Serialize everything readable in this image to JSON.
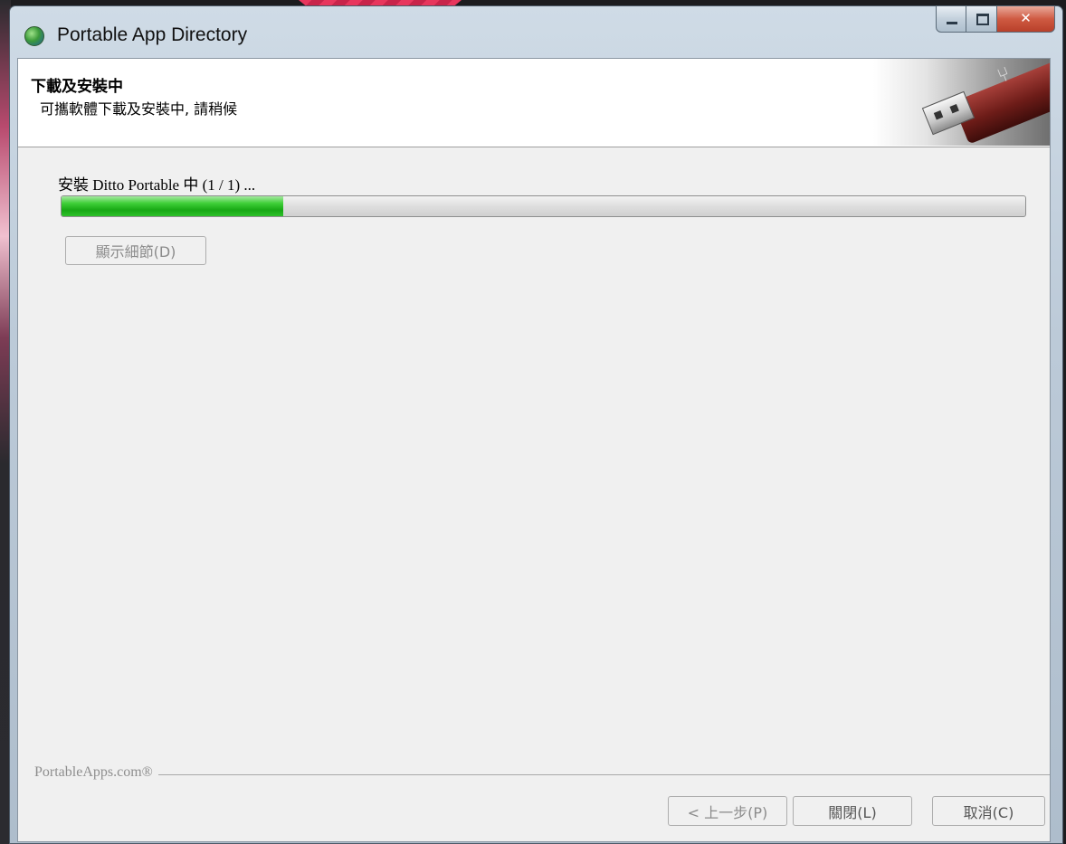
{
  "window": {
    "title": "Portable App Directory",
    "icon": "portableapps-globe-icon"
  },
  "caption_buttons": [
    "minimize",
    "maximize",
    "close"
  ],
  "header": {
    "title": "下載及安裝中",
    "subtitle": "可攜軟體下載及安裝中, 請稍候",
    "art": "usb-flash-drive-image"
  },
  "install": {
    "status_text": "安裝 Ditto Portable 中 (1 / 1) ...",
    "progress_fraction": 0.23,
    "progress_color": "#2ec12a"
  },
  "buttons": {
    "show_details": "顯示細節(D)",
    "back": "< 上一步(P)",
    "close": "關閉(L)",
    "cancel": "取消(C)"
  },
  "branding": "PortableApps.com®"
}
